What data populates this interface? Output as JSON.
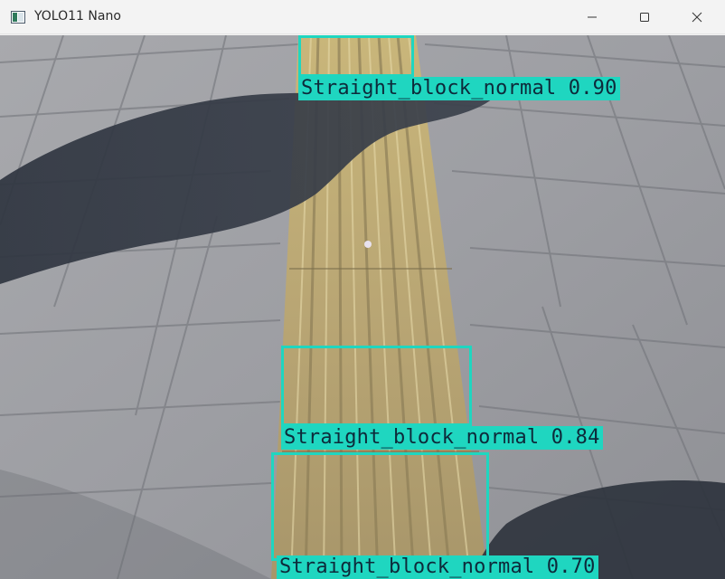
{
  "window": {
    "title": "YOLO11 Nano",
    "icons": {
      "app": "app-window-icon",
      "minimize": "minimize-icon",
      "maximize": "maximize-icon",
      "close": "close-icon"
    }
  },
  "colors": {
    "detection": "#1fd6c0",
    "label_text": "#0d2a3a"
  },
  "detections": [
    {
      "class_name": "Straight_block_normal",
      "confidence": "0.90",
      "label": "Straight_block_normal 0.90"
    },
    {
      "class_name": "Straight_block_normal",
      "confidence": "0.84",
      "label": "Straight_block_normal 0.84"
    },
    {
      "class_name": "Straight_block_normal",
      "confidence": "0.70",
      "label": "Straight_block_normal 0.70"
    }
  ]
}
